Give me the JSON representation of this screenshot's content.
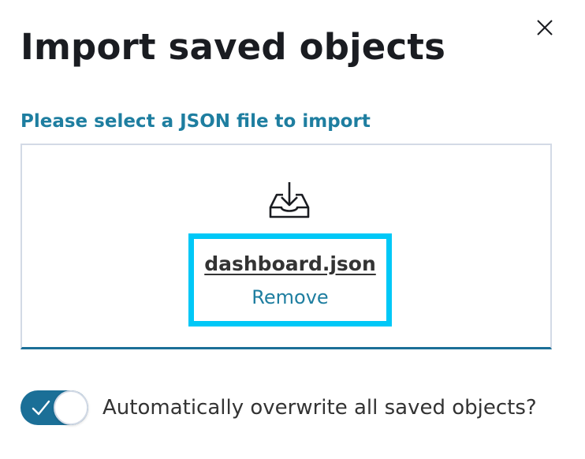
{
  "modal": {
    "title": "Import saved objects",
    "close_icon": "close-icon"
  },
  "file_picker": {
    "label": "Please select a JSON file to import",
    "icon": "upload-tray-icon",
    "file_name": "dashboard.json",
    "remove_label": "Remove",
    "highlight_color": "#00c8f7",
    "accent_color": "#1b6f97"
  },
  "overwrite_toggle": {
    "label": "Automatically overwrite all saved objects?",
    "checked": true,
    "on_color": "#1b6f97"
  }
}
